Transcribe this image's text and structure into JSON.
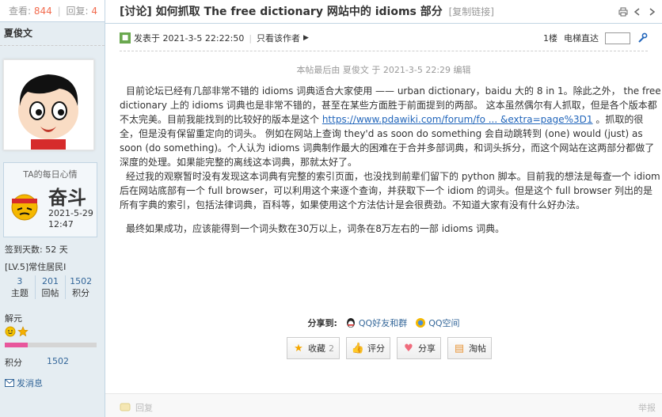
{
  "header": {
    "views_label": "查看:",
    "views": "844",
    "sep": "|",
    "replies_label": "回复:",
    "replies": "4",
    "title": "[讨论] 如何抓取 The free dictionary 网站中的 idioms 部分",
    "copy_link": "[复制链接]"
  },
  "author": {
    "name": "夏俊文",
    "mood_title": "TA的每日心情",
    "mood_word": "奋斗",
    "mood_date": "2021-5-29",
    "mood_time": "12:47",
    "checkin_days": "签到天数: 52 天",
    "level": "[LV.5]常住居民I",
    "stats": [
      {
        "value": "3",
        "label": "主题"
      },
      {
        "value": "201",
        "label": "回帖"
      },
      {
        "value": "1502",
        "label": "积分"
      }
    ],
    "medals_label": "解元",
    "points_label": "积分",
    "points_value": "1502",
    "send_message": "发消息",
    "progress_fraction": 0.25
  },
  "post": {
    "posted_label": "发表于 2021-3-5 22:22:50",
    "only_author": "只看该作者",
    "floor": "1楼",
    "goto_label": "电梯直达",
    "edited": "本帖最后由 夏俊文 于 2021-3-5 22:29 编辑",
    "p1_a": "目前论坛已经有几部非常不错的 idioms 词典适合大家使用 —— urban dictionary，baidu 大的 8 in 1。除此之外， the free dictionary 上的 idioms 词典也是非常不错的，甚至在某些方面胜于前面提到的两部。 这本虽然偶尔有人抓取，但是各个版本都不太完美。目前我能找到的比较好的版本是这个 ",
    "p1_link": "https://www.pdawiki.com/forum/fo ... &extra=page%3D1",
    "p1_b": " 。抓取的很全，但是没有保留重定向的词头。 例如在网站上查询 they'd as soon do something 会自动跳转到 (one) would (just) as soon (do something)。个人认为 idioms 词典制作最大的困难在于合并多部词典，和词头拆分，而这个网站在这两部分都做了深度的处理。如果能完整的离线这本词典，那就太好了。",
    "p2": "经过我的观察暂时没有发现这本词典有完整的索引页面，也没找到前辈们留下的 python 脚本。目前我的想法是每查一个 idiom 后在网站底部有一个 full browser，可以利用这个来逐个查询，并获取下一个 idiom 的词头。但是这个 full browser 列出的是所有字典的索引，包括法律词典，百科等，如果使用这个方法估计是会很费劲。不知道大家有没有什么好办法。",
    "p3": "最终如果成功，应该能得到一个词头数在30万以上，词条在8万左右的一部 idioms 词典。"
  },
  "share": {
    "label": "分享到:",
    "qq_friends": "QQ好友和群",
    "qq_zone": "QQ空间"
  },
  "actions": {
    "favorite": "收藏",
    "favorite_count": "2",
    "rate": "评分",
    "share": "分享",
    "sea": "淘帖"
  },
  "footer": {
    "reply": "回复",
    "report": "举报"
  },
  "colors": {
    "sidebar_bg": "#e5edf2",
    "border": "#c2d5e3",
    "accent_red": "#f26c4f",
    "link": "#2266bb",
    "progress": "#e8569c"
  }
}
